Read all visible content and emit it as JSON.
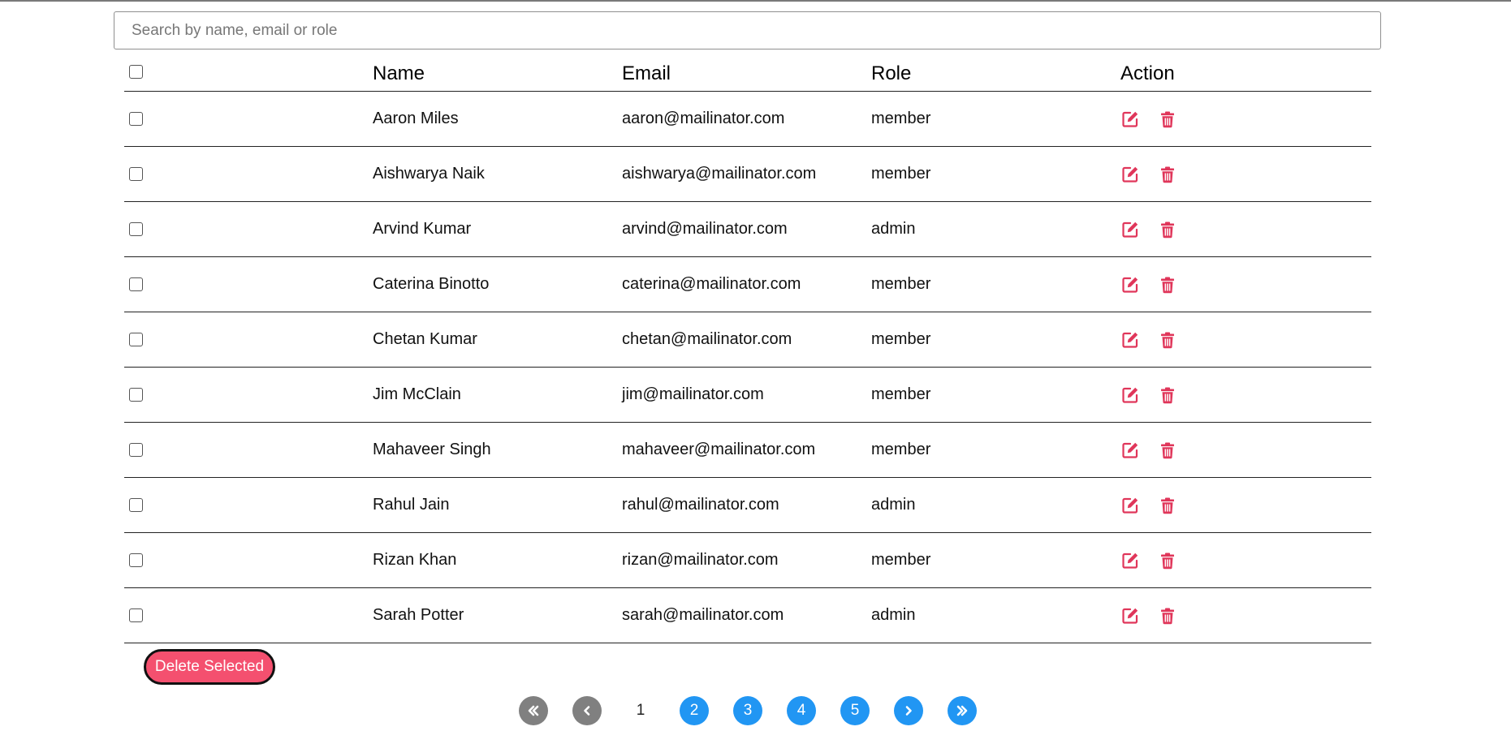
{
  "search": {
    "placeholder": "Search by name, email or role",
    "value": ""
  },
  "table": {
    "headers": {
      "name": "Name",
      "email": "Email",
      "role": "Role",
      "action": "Action"
    },
    "rows": [
      {
        "name": "Aaron Miles",
        "email": "aaron@mailinator.com",
        "role": "member"
      },
      {
        "name": "Aishwarya Naik",
        "email": "aishwarya@mailinator.com",
        "role": "member"
      },
      {
        "name": "Arvind Kumar",
        "email": "arvind@mailinator.com",
        "role": "admin"
      },
      {
        "name": "Caterina Binotto",
        "email": "caterina@mailinator.com",
        "role": "member"
      },
      {
        "name": "Chetan Kumar",
        "email": "chetan@mailinator.com",
        "role": "member"
      },
      {
        "name": "Jim McClain",
        "email": "jim@mailinator.com",
        "role": "member"
      },
      {
        "name": "Mahaveer Singh",
        "email": "mahaveer@mailinator.com",
        "role": "member"
      },
      {
        "name": "Rahul Jain",
        "email": "rahul@mailinator.com",
        "role": "admin"
      },
      {
        "name": "Rizan Khan",
        "email": "rizan@mailinator.com",
        "role": "member"
      },
      {
        "name": "Sarah Potter",
        "email": "sarah@mailinator.com",
        "role": "admin"
      }
    ],
    "row_icons": {
      "edit": "edit-icon",
      "delete": "trash-icon"
    }
  },
  "actions": {
    "delete_selected_label": "Delete Selected"
  },
  "pagination": {
    "icons": {
      "first": "double-chevron-left-icon",
      "prev": "chevron-left-icon",
      "next": "chevron-right-icon",
      "last": "double-chevron-right-icon"
    },
    "pages": [
      "1",
      "2",
      "3",
      "4",
      "5"
    ],
    "current_page": "1"
  },
  "colors": {
    "accent_red": "#e0365a",
    "delete_button_bg": "#f4506f",
    "page_blue": "#2196f3",
    "nav_gray": "#808080"
  }
}
